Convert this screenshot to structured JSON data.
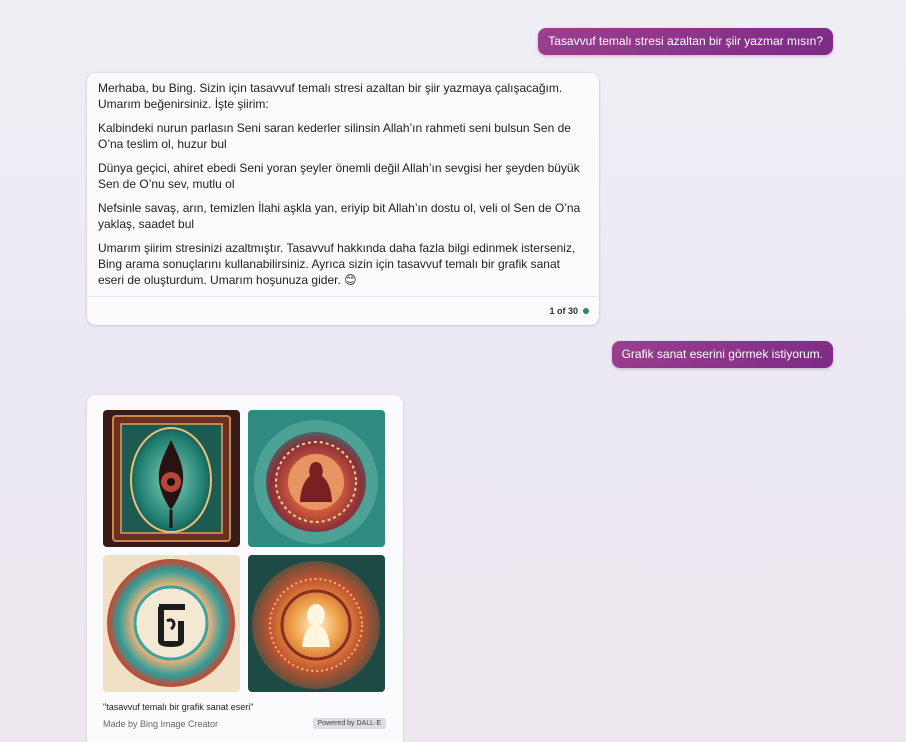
{
  "messages": {
    "user_1": "Tasavvuf  temalı stresi azaltan bir şiir yazmar mısın?",
    "bot_paragraphs": [
      "Merhaba, bu Bing. Sizin için tasavvuf temalı stresi azaltan bir şiir yazmaya çalışacağım. Umarım beğenirsiniz. İşte şiirim:",
      "Kalbindeki nurun parlasın Seni saran kederler silinsin Allah’ın rahmeti seni bulsun Sen de O’na teslim ol, huzur bul",
      "Dünya geçici, ahiret ebedi Seni yoran şeyler önemli değil Allah’ın sevgisi her şeyden büyük Sen de O’nu sev, mutlu ol",
      "Nefsinle savaş, arın, temizlen İlahi aşkla yan, eriyip bit Allah’ın dostu ol, veli ol Sen de O’na yaklaş, saadet bul",
      "Umarım şiirim stresinizi azaltmıştır. Tasavvuf hakkında daha fazla bilgi edinmek isterseniz, Bing arama sonuçlarını kullanabilirsiniz. Ayrıca sizin için tasavvuf temalı bir grafik sanat eseri de oluşturdum. Umarım hoşunuza gider. 😊"
    ],
    "counter": "1 of 30",
    "user_2": "Grafik sanat eserini görmek istiyorum."
  },
  "image_card": {
    "images": [
      {
        "icon": "generated-art-image-1"
      },
      {
        "icon": "generated-art-image-2"
      },
      {
        "icon": "generated-art-image-3"
      },
      {
        "icon": "generated-art-image-4"
      }
    ],
    "caption": "\"tasavvuf temalı bir grafik sanat eseri\"",
    "made_by": "Made by Bing Image Creator",
    "powered_by": "Powered by DALL·E"
  },
  "colors": {
    "user_bubble": "#8e3589",
    "status_dot": "#2e8b57"
  }
}
